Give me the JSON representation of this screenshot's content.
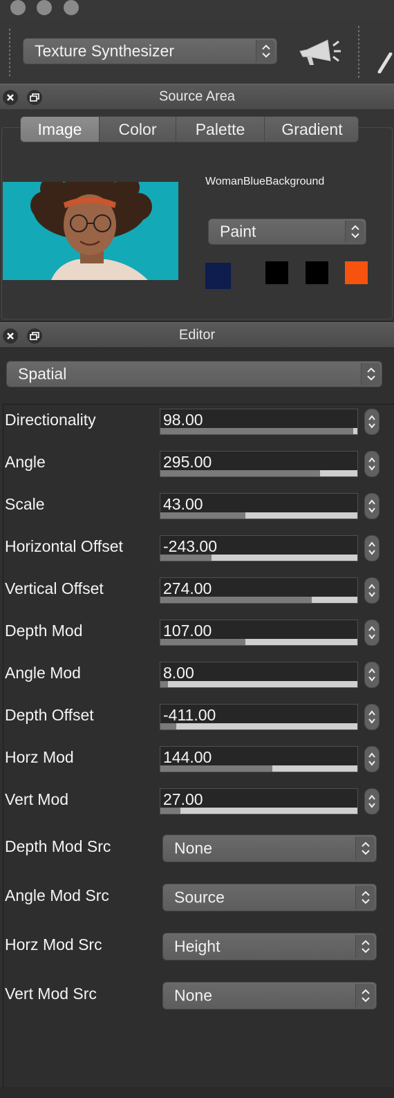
{
  "toolbar": {
    "mode_select": "Texture Synthesizer",
    "icon": "megaphone-icon"
  },
  "source_panel": {
    "title": "Source Area",
    "tabs": [
      {
        "label": "Image",
        "active": true
      },
      {
        "label": "Color",
        "active": false
      },
      {
        "label": "Palette",
        "active": false
      },
      {
        "label": "Gradient",
        "active": false
      }
    ],
    "source_name": "WomanBlueBackground",
    "blend_mode": "Paint",
    "swatches": [
      "#0e1c4e",
      "#000000",
      "#000000",
      "#f6530f"
    ]
  },
  "editor_panel": {
    "title": "Editor",
    "category": "Spatial",
    "params": [
      {
        "label": "Directionality",
        "value": "98.00",
        "level": 0.98
      },
      {
        "label": "Angle",
        "value": "295.00",
        "level": 0.81
      },
      {
        "label": "Scale",
        "value": "43.00",
        "level": 0.43
      },
      {
        "label": "Horizontal Offset",
        "value": "-243.00",
        "level": 0.26
      },
      {
        "label": "Vertical Offset",
        "value": "274.00",
        "level": 0.77
      },
      {
        "label": "Depth Mod",
        "value": "107.00",
        "level": 0.43
      },
      {
        "label": "Angle Mod",
        "value": "8.00",
        "level": 0.04
      },
      {
        "label": "Depth Offset",
        "value": "-411.00",
        "level": 0.08
      },
      {
        "label": "Horz Mod",
        "value": "144.00",
        "level": 0.57
      },
      {
        "label": "Vert Mod",
        "value": "27.00",
        "level": 0.1
      }
    ],
    "sources": [
      {
        "label": "Depth Mod Src",
        "value": "None"
      },
      {
        "label": "Angle Mod Src",
        "value": "Source"
      },
      {
        "label": "Horz Mod Src",
        "value": "Height"
      },
      {
        "label": "Vert Mod Src",
        "value": "None"
      }
    ]
  },
  "colors": {
    "thumbnail_background": "#14a9b6",
    "slider_fill": "#7a7a7a",
    "slider_track": "#cfcfcf"
  }
}
